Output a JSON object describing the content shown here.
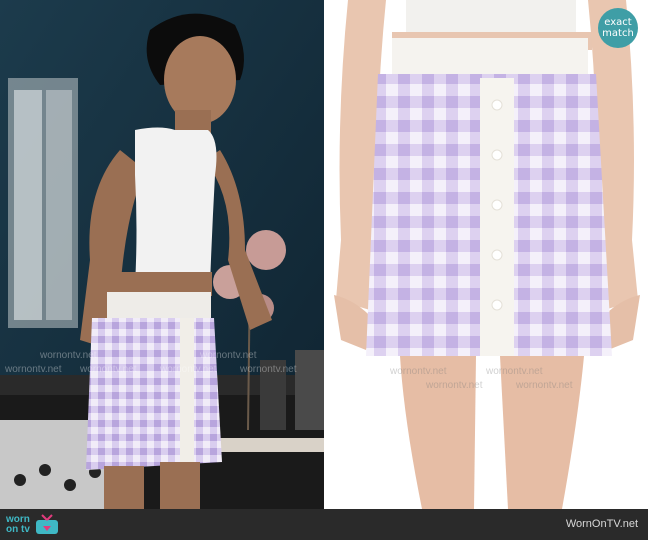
{
  "badge": {
    "line1": "exact",
    "line2": "match"
  },
  "footer": {
    "logo_line1": "worn",
    "logo_line2": "on tv",
    "site": "WornOnTV.net"
  },
  "watermark": "wornontv.net",
  "colors": {
    "badge": "#3f9ea6",
    "footer_bg": "#2a2a2a",
    "logo": "#3fb8c5",
    "skirt_lilac": "#c9b8e6"
  }
}
